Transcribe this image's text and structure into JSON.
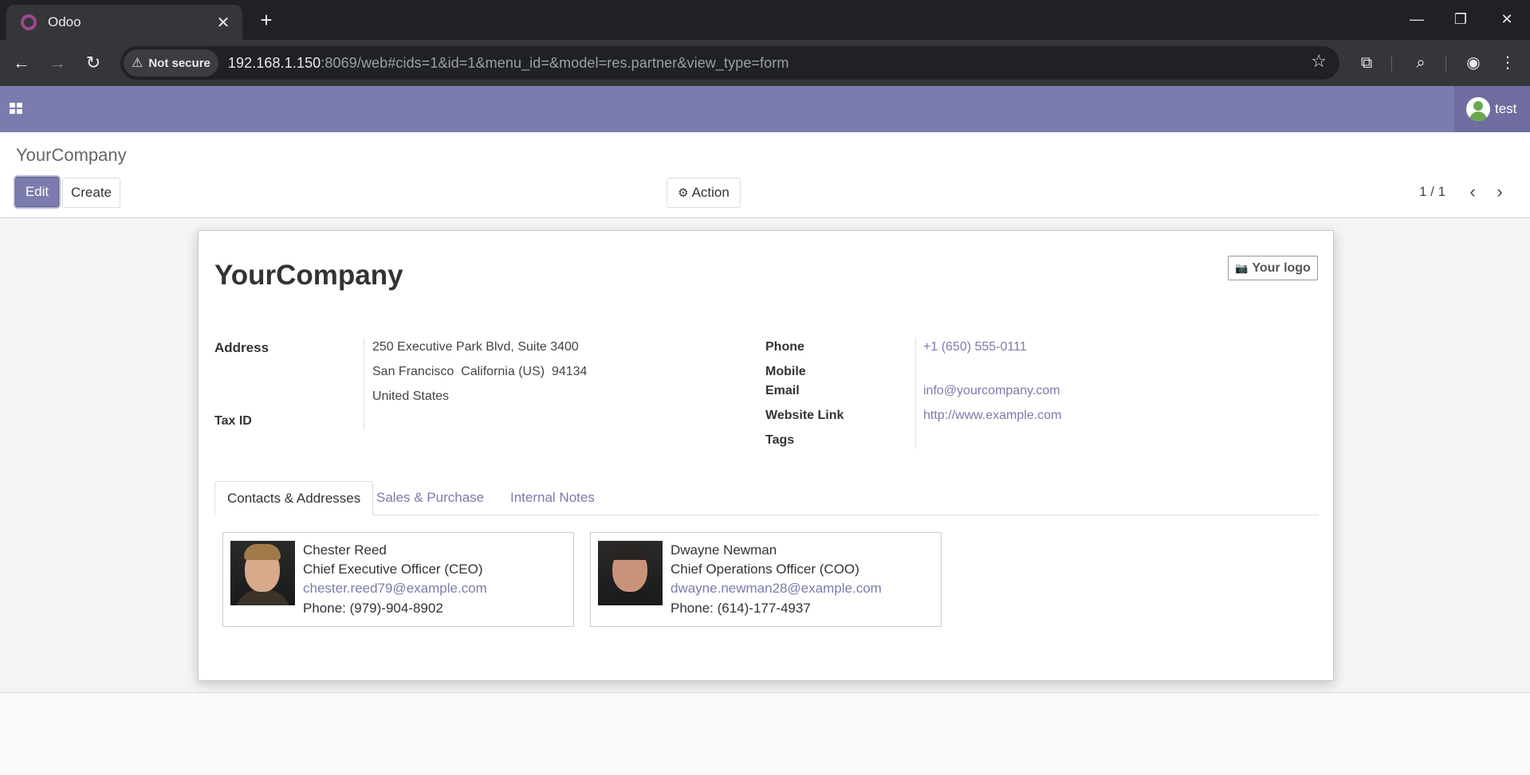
{
  "browser": {
    "tab_title": "Odoo",
    "security_label": "Not secure",
    "url_host": "192.168.1.150",
    "url_rest": ":8069/web#cids=1&id=1&menu_id=&model=res.partner&view_type=form"
  },
  "navbar": {
    "user_name": "test"
  },
  "control_panel": {
    "breadcrumb": "YourCompany",
    "edit_label": "Edit",
    "create_label": "Create",
    "action_label": "Action",
    "pager": "1 / 1"
  },
  "form": {
    "name": "YourCompany",
    "logo_label": "Your logo",
    "labels": {
      "address": "Address",
      "tax_id": "Tax ID",
      "phone": "Phone",
      "mobile": "Mobile",
      "email": "Email",
      "website": "Website Link",
      "tags": "Tags"
    },
    "address": {
      "street": "250 Executive Park Blvd, Suite 3400",
      "city_line": "San Francisco  California (US)  94134",
      "country": "United States"
    },
    "phone": "+1 (650) 555-0111",
    "email": "info@yourcompany.com",
    "website": "http://www.example.com"
  },
  "tabs": [
    {
      "label": "Contacts & Addresses"
    },
    {
      "label": "Sales & Purchase"
    },
    {
      "label": "Internal Notes"
    }
  ],
  "contacts": [
    {
      "name": "Chester Reed",
      "role": "Chief Executive Officer (CEO)",
      "email": "chester.reed79@example.com",
      "phone": "Phone: (979)-904-8902"
    },
    {
      "name": "Dwayne Newman",
      "role": "Chief Operations Officer (COO)",
      "email": "dwayne.newman28@example.com",
      "phone": "Phone: (614)-177-4937"
    }
  ],
  "colors": {
    "brand": "#7c7bad",
    "link": "#7c7bad"
  }
}
